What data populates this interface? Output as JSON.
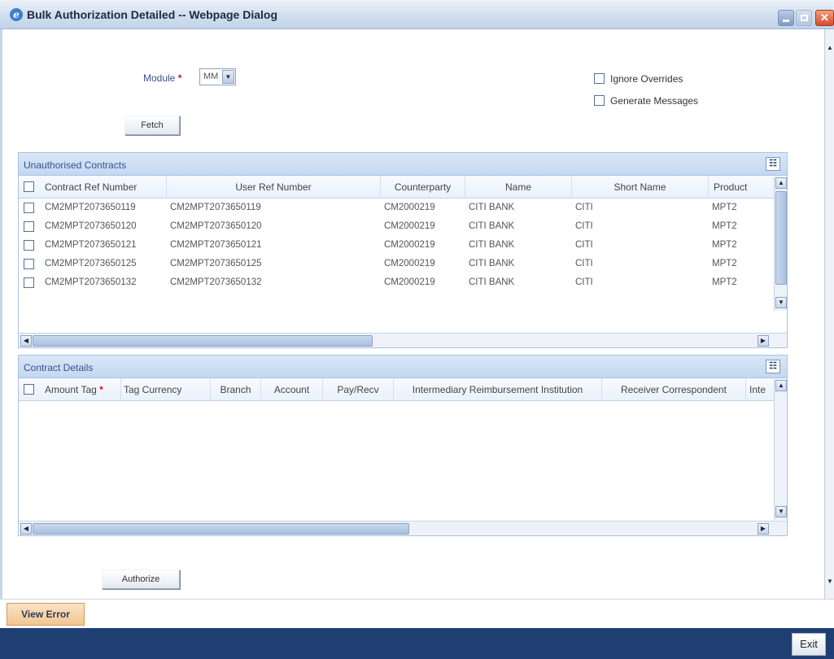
{
  "window": {
    "title": "Bulk Authorization Detailed -- Webpage Dialog"
  },
  "form": {
    "module_label": "Module",
    "module_value": "MM",
    "required_mark": "*",
    "ignore_overrides_label": "Ignore Overrides",
    "generate_messages_label": "Generate Messages",
    "fetch_label": "Fetch",
    "authorize_label": "Authorize"
  },
  "unauthorised": {
    "title": "Unauthorised Contracts",
    "columns": [
      "Contract Ref Number",
      "User Ref Number",
      "Counterparty",
      "Name",
      "Short Name",
      "Product"
    ],
    "rows": [
      [
        "CM2MPT2073650119",
        "CM2MPT2073650119",
        "CM2000219",
        "CITI BANK",
        "CITI",
        "MPT2"
      ],
      [
        "CM2MPT2073650120",
        "CM2MPT2073650120",
        "CM2000219",
        "CITI BANK",
        "CITI",
        "MPT2"
      ],
      [
        "CM2MPT2073650121",
        "CM2MPT2073650121",
        "CM2000219",
        "CITI BANK",
        "CITI",
        "MPT2"
      ],
      [
        "CM2MPT2073650125",
        "CM2MPT2073650125",
        "CM2000219",
        "CITI BANK",
        "CITI",
        "MPT2"
      ],
      [
        "CM2MPT2073650132",
        "CM2MPT2073650132",
        "CM2000219",
        "CITI BANK",
        "CITI",
        "MPT2"
      ]
    ]
  },
  "details": {
    "title": "Contract Details",
    "columns": [
      "Amount Tag",
      "Tag Currency",
      "Branch",
      "Account",
      "Pay/Recv",
      "Intermediary Reimbursement Institution",
      "Receiver Correspondent",
      "Inte"
    ]
  },
  "bottom": {
    "view_error_label": "View Error",
    "exit_label": "Exit"
  },
  "colors": {
    "title_bar": "#c2d3ea",
    "footer": "#1f3f73",
    "grid_header": "#c3d8f1",
    "view_error_bg": "#f2c591"
  }
}
